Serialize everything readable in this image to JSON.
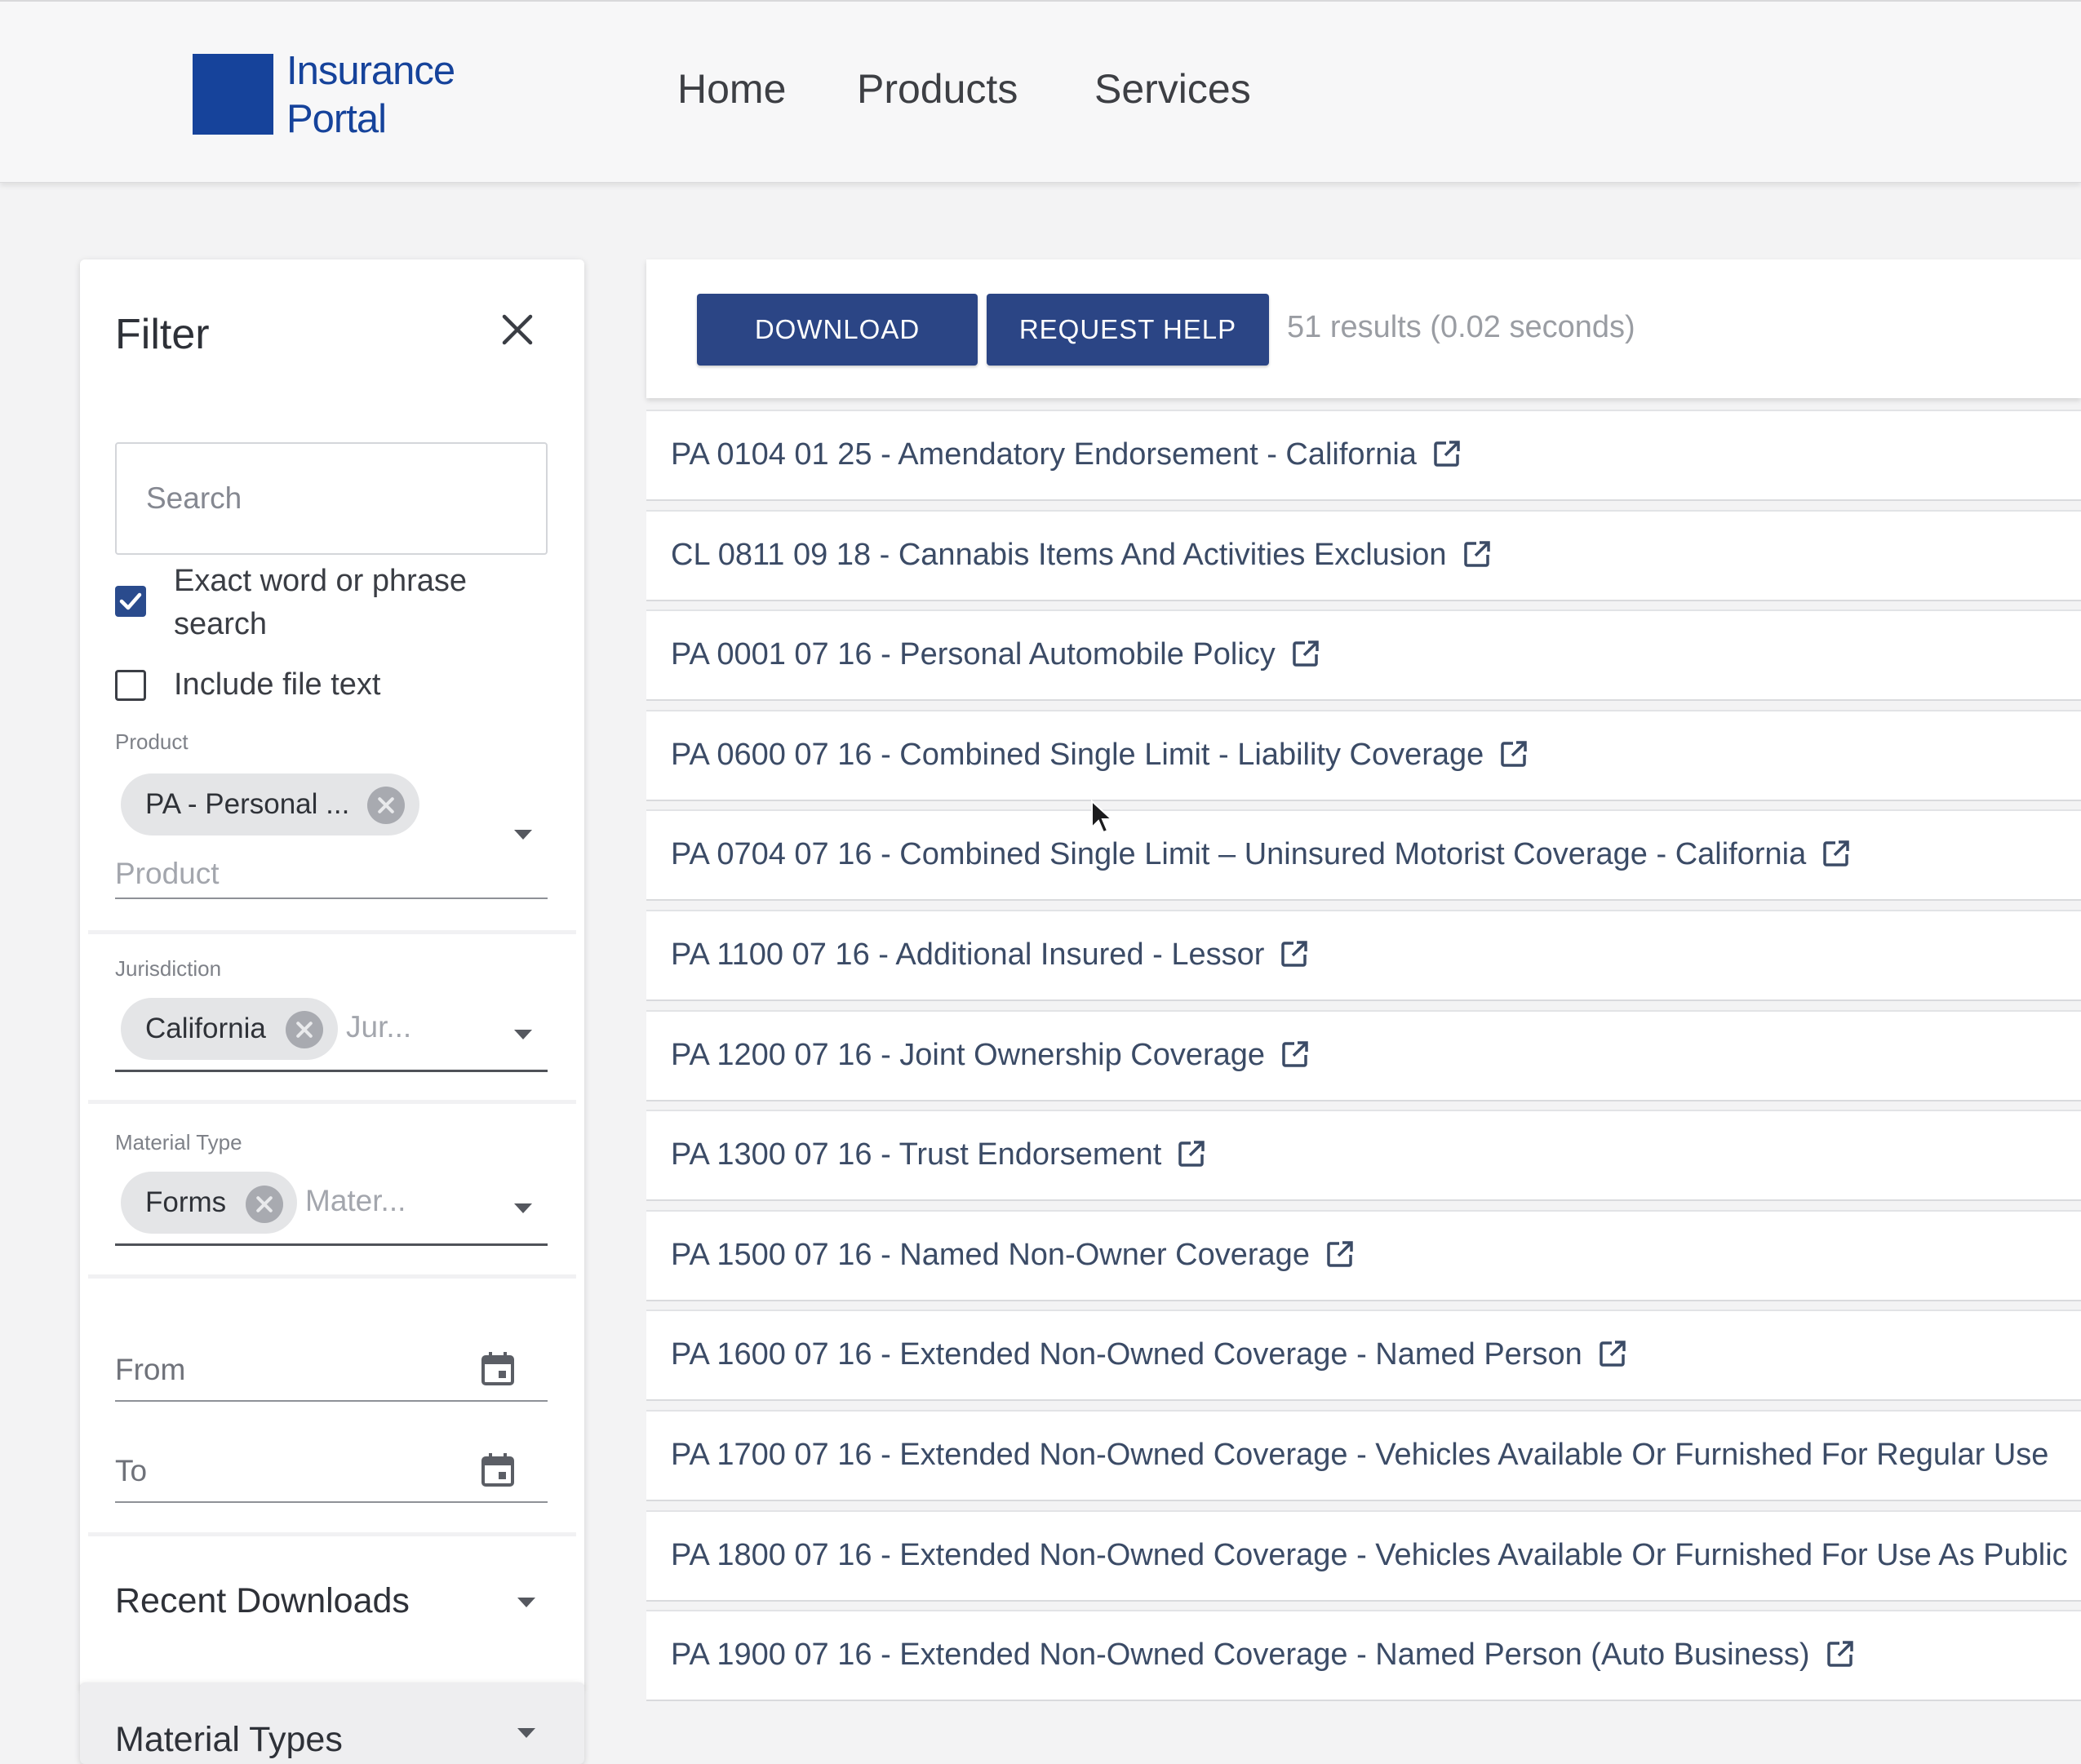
{
  "header": {
    "logo_line1": "Insurance",
    "logo_line2": "Portal",
    "nav": [
      "Home",
      "Products",
      "Services"
    ]
  },
  "colors": {
    "brand": "#16439b",
    "button": "#2b4585",
    "link_text": "#3b4b66"
  },
  "filter": {
    "title": "Filter",
    "close_icon": "close-icon",
    "search_placeholder": "Search",
    "exact_checkbox": {
      "label_line1": "Exact word or phrase",
      "label_line2": "search",
      "checked": true
    },
    "file_text_checkbox": {
      "label": "Include file text",
      "checked": false
    },
    "product": {
      "label": "Product",
      "chip": "PA - Personal ...",
      "placeholder": "Product"
    },
    "jurisdiction": {
      "label": "Jurisdiction",
      "chip": "California",
      "placeholder": "Jur..."
    },
    "material_type": {
      "label": "Material Type",
      "chip": "Forms",
      "placeholder": "Mater..."
    },
    "from_label": "From",
    "to_label": "To",
    "recent_downloads": "Recent Downloads",
    "material_types": "Material Types"
  },
  "toolbar": {
    "download": "DOWNLOAD",
    "request_help": "REQUEST HELP",
    "results_count": "51 results (0.02 seconds)"
  },
  "results": [
    {
      "title": "PA 0104 01 25 - Amendatory Endorsement - California",
      "ext": true
    },
    {
      "title": "CL 0811 09 18 - Cannabis Items And Activities Exclusion",
      "ext": true
    },
    {
      "title": "PA 0001 07 16 - Personal Automobile Policy",
      "ext": true
    },
    {
      "title": "PA 0600 07 16 - Combined Single Limit - Liability Coverage",
      "ext": true
    },
    {
      "title": "PA 0704 07 16 - Combined Single Limit – Uninsured Motorist Coverage - California",
      "ext": true
    },
    {
      "title": "PA 1100 07 16 - Additional Insured - Lessor",
      "ext": true
    },
    {
      "title": "PA 1200 07 16 - Joint Ownership Coverage",
      "ext": true
    },
    {
      "title": "PA 1300 07 16 - Trust Endorsement",
      "ext": true
    },
    {
      "title": "PA 1500 07 16 - Named Non-Owner Coverage",
      "ext": true
    },
    {
      "title": "PA 1600 07 16 - Extended Non-Owned Coverage - Named Person",
      "ext": true
    },
    {
      "title": "PA 1700 07 16 - Extended Non-Owned Coverage - Vehicles Available Or Furnished For Regular Use",
      "ext": false
    },
    {
      "title": "PA 1800 07 16 - Extended Non-Owned Coverage - Vehicles Available Or Furnished For Use As Public",
      "ext": false
    },
    {
      "title": "PA 1900 07 16 - Extended Non-Owned Coverage - Named Person (Auto Business)",
      "ext": true
    }
  ]
}
